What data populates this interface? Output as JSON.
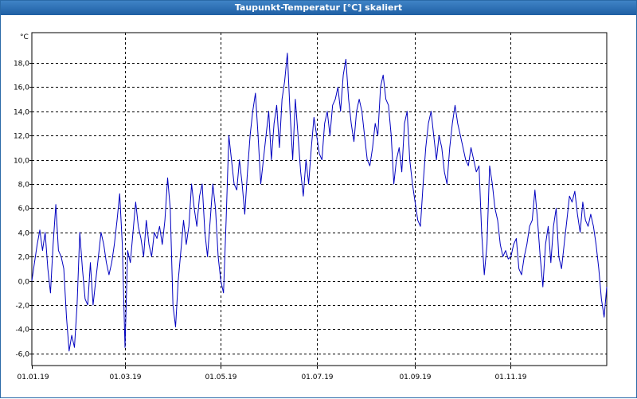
{
  "window": {
    "title": "Taupunkt-Temperatur [°C] skaliert"
  },
  "chart_data": {
    "type": "line",
    "title": "Taupunkt-Temperatur [°C] skaliert",
    "ylabel": "°C",
    "xlabel": "",
    "ylim": [
      -7,
      20.5
    ],
    "xlim": [
      0,
      365
    ],
    "grid": true,
    "y_ticks": [
      -6,
      -4,
      -2,
      0,
      2,
      4,
      6,
      8,
      10,
      12,
      14,
      16,
      18
    ],
    "y_tick_labels": [
      "-6,0",
      "-4,0",
      "-2,0",
      "0,0",
      "2,0",
      "4,0",
      "6,0",
      "8,0",
      "10,0",
      "12,0",
      "14,0",
      "16,0",
      "18,0"
    ],
    "x_ticks": [
      0,
      59,
      120,
      181,
      243,
      304
    ],
    "x_tick_labels": [
      "01.01.19",
      "01.03.19",
      "01.05.19",
      "01.07.19",
      "01.09.19",
      "01.11.19"
    ],
    "line_color": "#0000c0",
    "series": [
      {
        "values": [
          0.0,
          1.5,
          3.0,
          4.2,
          2.5,
          4.0,
          1.0,
          -1.0,
          3.0,
          6.3,
          2.5,
          2.0,
          1.0,
          -3.0,
          -5.8,
          -4.5,
          -5.5,
          -2.0,
          4.0,
          1.0,
          -1.5,
          -2.0,
          1.5,
          -2.0,
          0.0,
          2.0,
          4.0,
          3.0,
          1.5,
          0.5,
          1.5,
          3.0,
          5.0,
          7.2,
          3.0,
          -5.5,
          2.5,
          1.5,
          4.0,
          6.5,
          4.5,
          3.5,
          2.0,
          5.0,
          3.0,
          2.0,
          4.0,
          3.5,
          4.5,
          3.0,
          5.0,
          8.5,
          6.0,
          -2.0,
          -3.8,
          0.0,
          2.5,
          5.0,
          3.0,
          4.5,
          8.0,
          6.0,
          4.5,
          7.0,
          8.0,
          4.0,
          2.0,
          5.0,
          8.0,
          6.0,
          2.0,
          0.0,
          -1.0,
          5.0,
          12.0,
          10.0,
          8.0,
          7.5,
          10.0,
          8.0,
          5.5,
          9.0,
          12.0,
          14.0,
          15.5,
          12.0,
          8.0,
          10.0,
          12.0,
          14.0,
          10.0,
          13.0,
          14.5,
          11.0,
          15.0,
          16.5,
          18.8,
          14.0,
          10.0,
          15.0,
          12.0,
          9.0,
          7.0,
          10.0,
          8.0,
          11.0,
          13.5,
          12.0,
          10.5,
          10.0,
          13.0,
          14.0,
          12.0,
          14.5,
          15.0,
          16.0,
          14.0,
          17.0,
          18.3,
          15.0,
          13.0,
          11.5,
          14.0,
          15.0,
          14.0,
          12.0,
          10.0,
          9.5,
          11.0,
          13.0,
          12.0,
          16.0,
          17.0,
          15.0,
          14.5,
          12.0,
          8.0,
          10.0,
          11.0,
          9.0,
          13.0,
          14.0,
          10.0,
          8.0,
          6.5,
          5.0,
          4.5,
          8.0,
          11.0,
          13.0,
          14.0,
          12.0,
          10.0,
          12.0,
          11.0,
          9.0,
          8.0,
          11.0,
          13.0,
          14.5,
          13.0,
          12.0,
          11.0,
          10.0,
          9.5,
          11.0,
          10.0,
          9.0,
          9.5,
          4.0,
          0.5,
          3.0,
          9.5,
          8.0,
          6.0,
          5.0,
          3.0,
          2.0,
          2.5,
          1.8,
          2.0,
          3.0,
          3.5,
          1.0,
          0.5,
          2.0,
          3.0,
          4.5,
          5.0,
          7.5,
          5.0,
          2.0,
          -0.5,
          3.0,
          4.5,
          1.5,
          4.5,
          6.0,
          2.0,
          1.0,
          3.0,
          5.0,
          7.0,
          6.5,
          7.4,
          5.5,
          4.0,
          6.5,
          5.0,
          4.5,
          5.5,
          4.5,
          3.0,
          1.0,
          -1.5,
          -3.0,
          -0.5
        ]
      }
    ]
  }
}
